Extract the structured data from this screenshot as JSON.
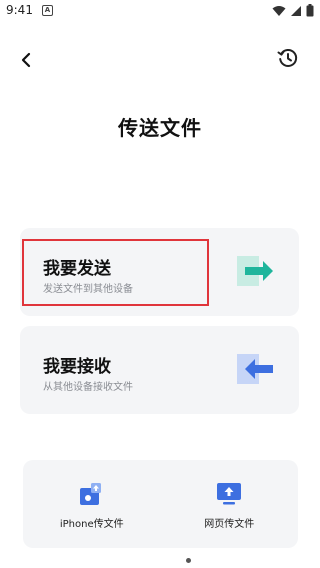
{
  "status_bar": {
    "time": "9:41",
    "notification_icon": "a-box-icon",
    "icons": [
      "wifi-icon",
      "signal-icon",
      "battery-icon"
    ]
  },
  "header": {
    "back_icon": "chevron-left-icon",
    "history_icon": "history-icon",
    "title": "传送文件"
  },
  "cards": [
    {
      "title": "我要发送",
      "subtitle": "发送文件到其他设备",
      "icon": "send-arrow-icon"
    },
    {
      "title": "我要接收",
      "subtitle": "从其他设备接收文件",
      "icon": "receive-arrow-icon"
    }
  ],
  "bottom_panel": [
    {
      "label": "iPhone传文件",
      "icon": "iphone-upload-icon"
    },
    {
      "label": "网页传文件",
      "icon": "monitor-upload-icon"
    }
  ],
  "colors": {
    "highlight": "#e0353b",
    "send_arrow": "#1fb59c",
    "receive_arrow": "#3d6fe0",
    "card_bg": "#f4f5f7"
  }
}
